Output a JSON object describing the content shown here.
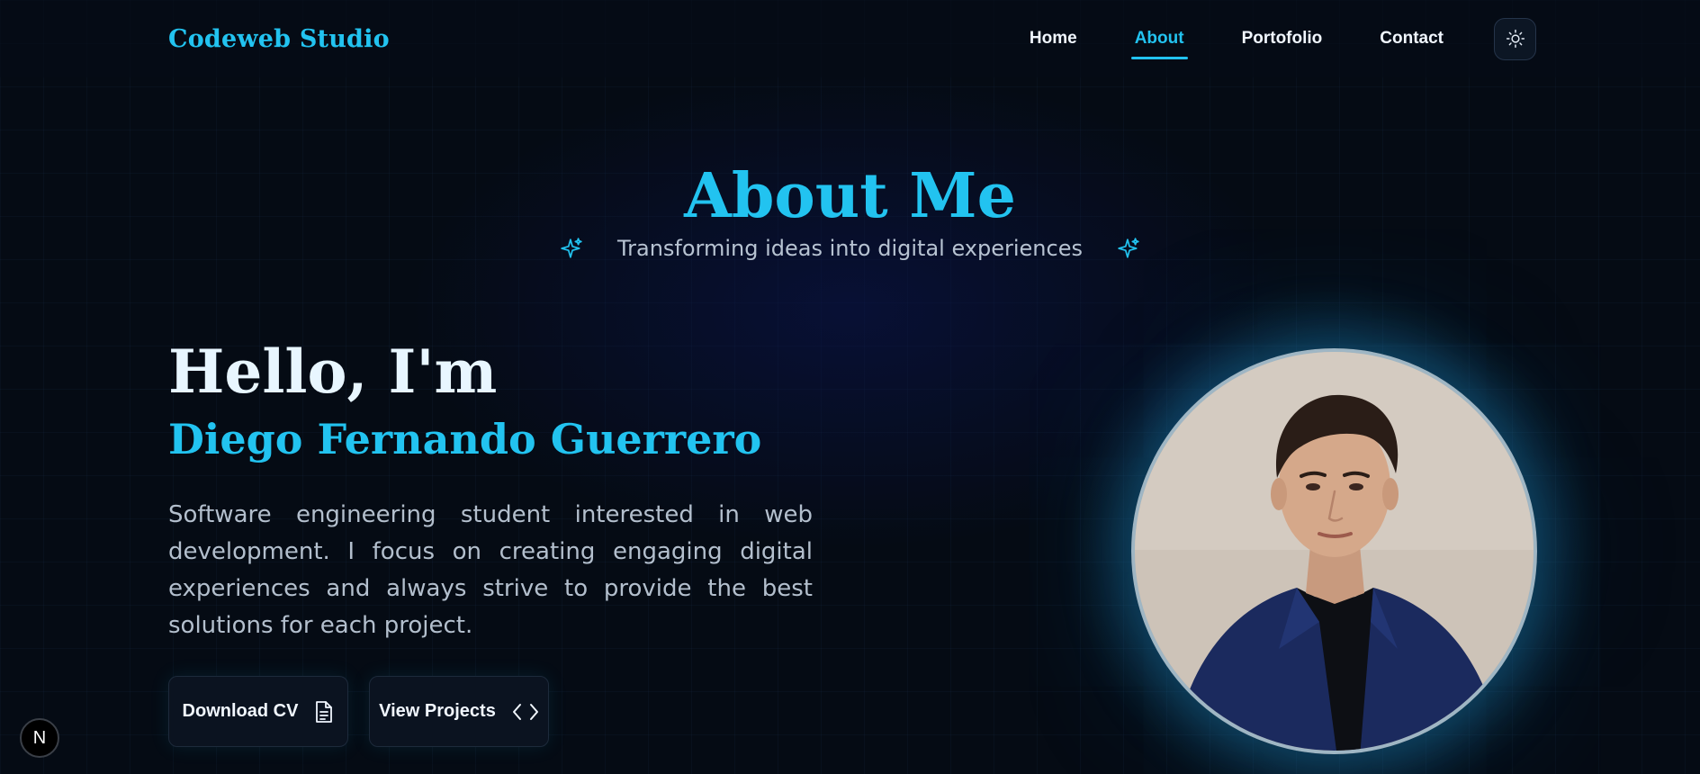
{
  "nav": {
    "brand": "Codeweb Studio",
    "links": [
      "Home",
      "About",
      "Portofolio",
      "Contact"
    ],
    "active": "About"
  },
  "header": {
    "title": "About Me",
    "subtitle": "Transforming ideas into digital experiences"
  },
  "hero": {
    "greeting": "Hello, I'm",
    "name": "Diego Fernando Guerrero",
    "bio": "Software engineering student interested in web development. I focus on creating engaging digital experiences and always strive to provide the best solutions for each project."
  },
  "buttons": {
    "download_label": "Download CV",
    "projects_label": "View Projects"
  },
  "badge": {
    "label": "N"
  },
  "colors": {
    "accent": "#22c3f0",
    "background": "#050b14",
    "text": "#e8f6ff",
    "muted": "#b3bfcd"
  },
  "icons": {
    "theme_toggle": "sun-icon",
    "sparkle": "sparkle-icon",
    "download": "document-icon",
    "projects": "code-brackets-icon"
  }
}
